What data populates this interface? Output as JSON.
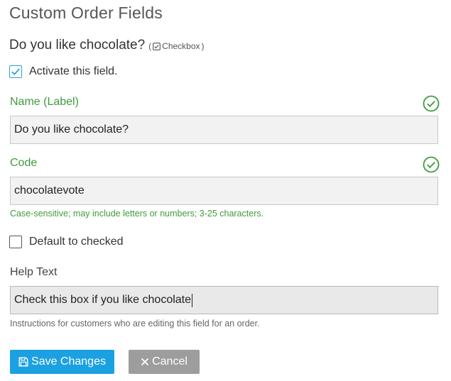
{
  "page": {
    "title": "Custom Order Fields"
  },
  "field": {
    "question": "Do you like chocolate?",
    "type_open": "(",
    "type_label": "Checkbox",
    "type_close": ")"
  },
  "activate": {
    "label": "Activate this field.",
    "checked": true
  },
  "name_field": {
    "label": "Name (Label)",
    "value": "Do you like chocolate?",
    "valid": true
  },
  "code_field": {
    "label": "Code",
    "value": "chocolatevote",
    "hint": "Case-sensitive; may include letters or numbers; 3-25 characters.",
    "valid": true
  },
  "default_checked": {
    "label": "Default to checked",
    "checked": false
  },
  "help_text_field": {
    "label": "Help Text",
    "value": "Check this box if you like chocolate",
    "hint": "Instructions for customers who are editing this field for an order."
  },
  "actions": {
    "save_label": "Save Changes",
    "cancel_label": "Cancel",
    "save_icon": "floppy-disk-icon",
    "cancel_icon": "close-icon"
  },
  "colors": {
    "accent": "#1ba1e2",
    "valid": "#3e9c3e",
    "cancel": "#9d9d9d"
  }
}
